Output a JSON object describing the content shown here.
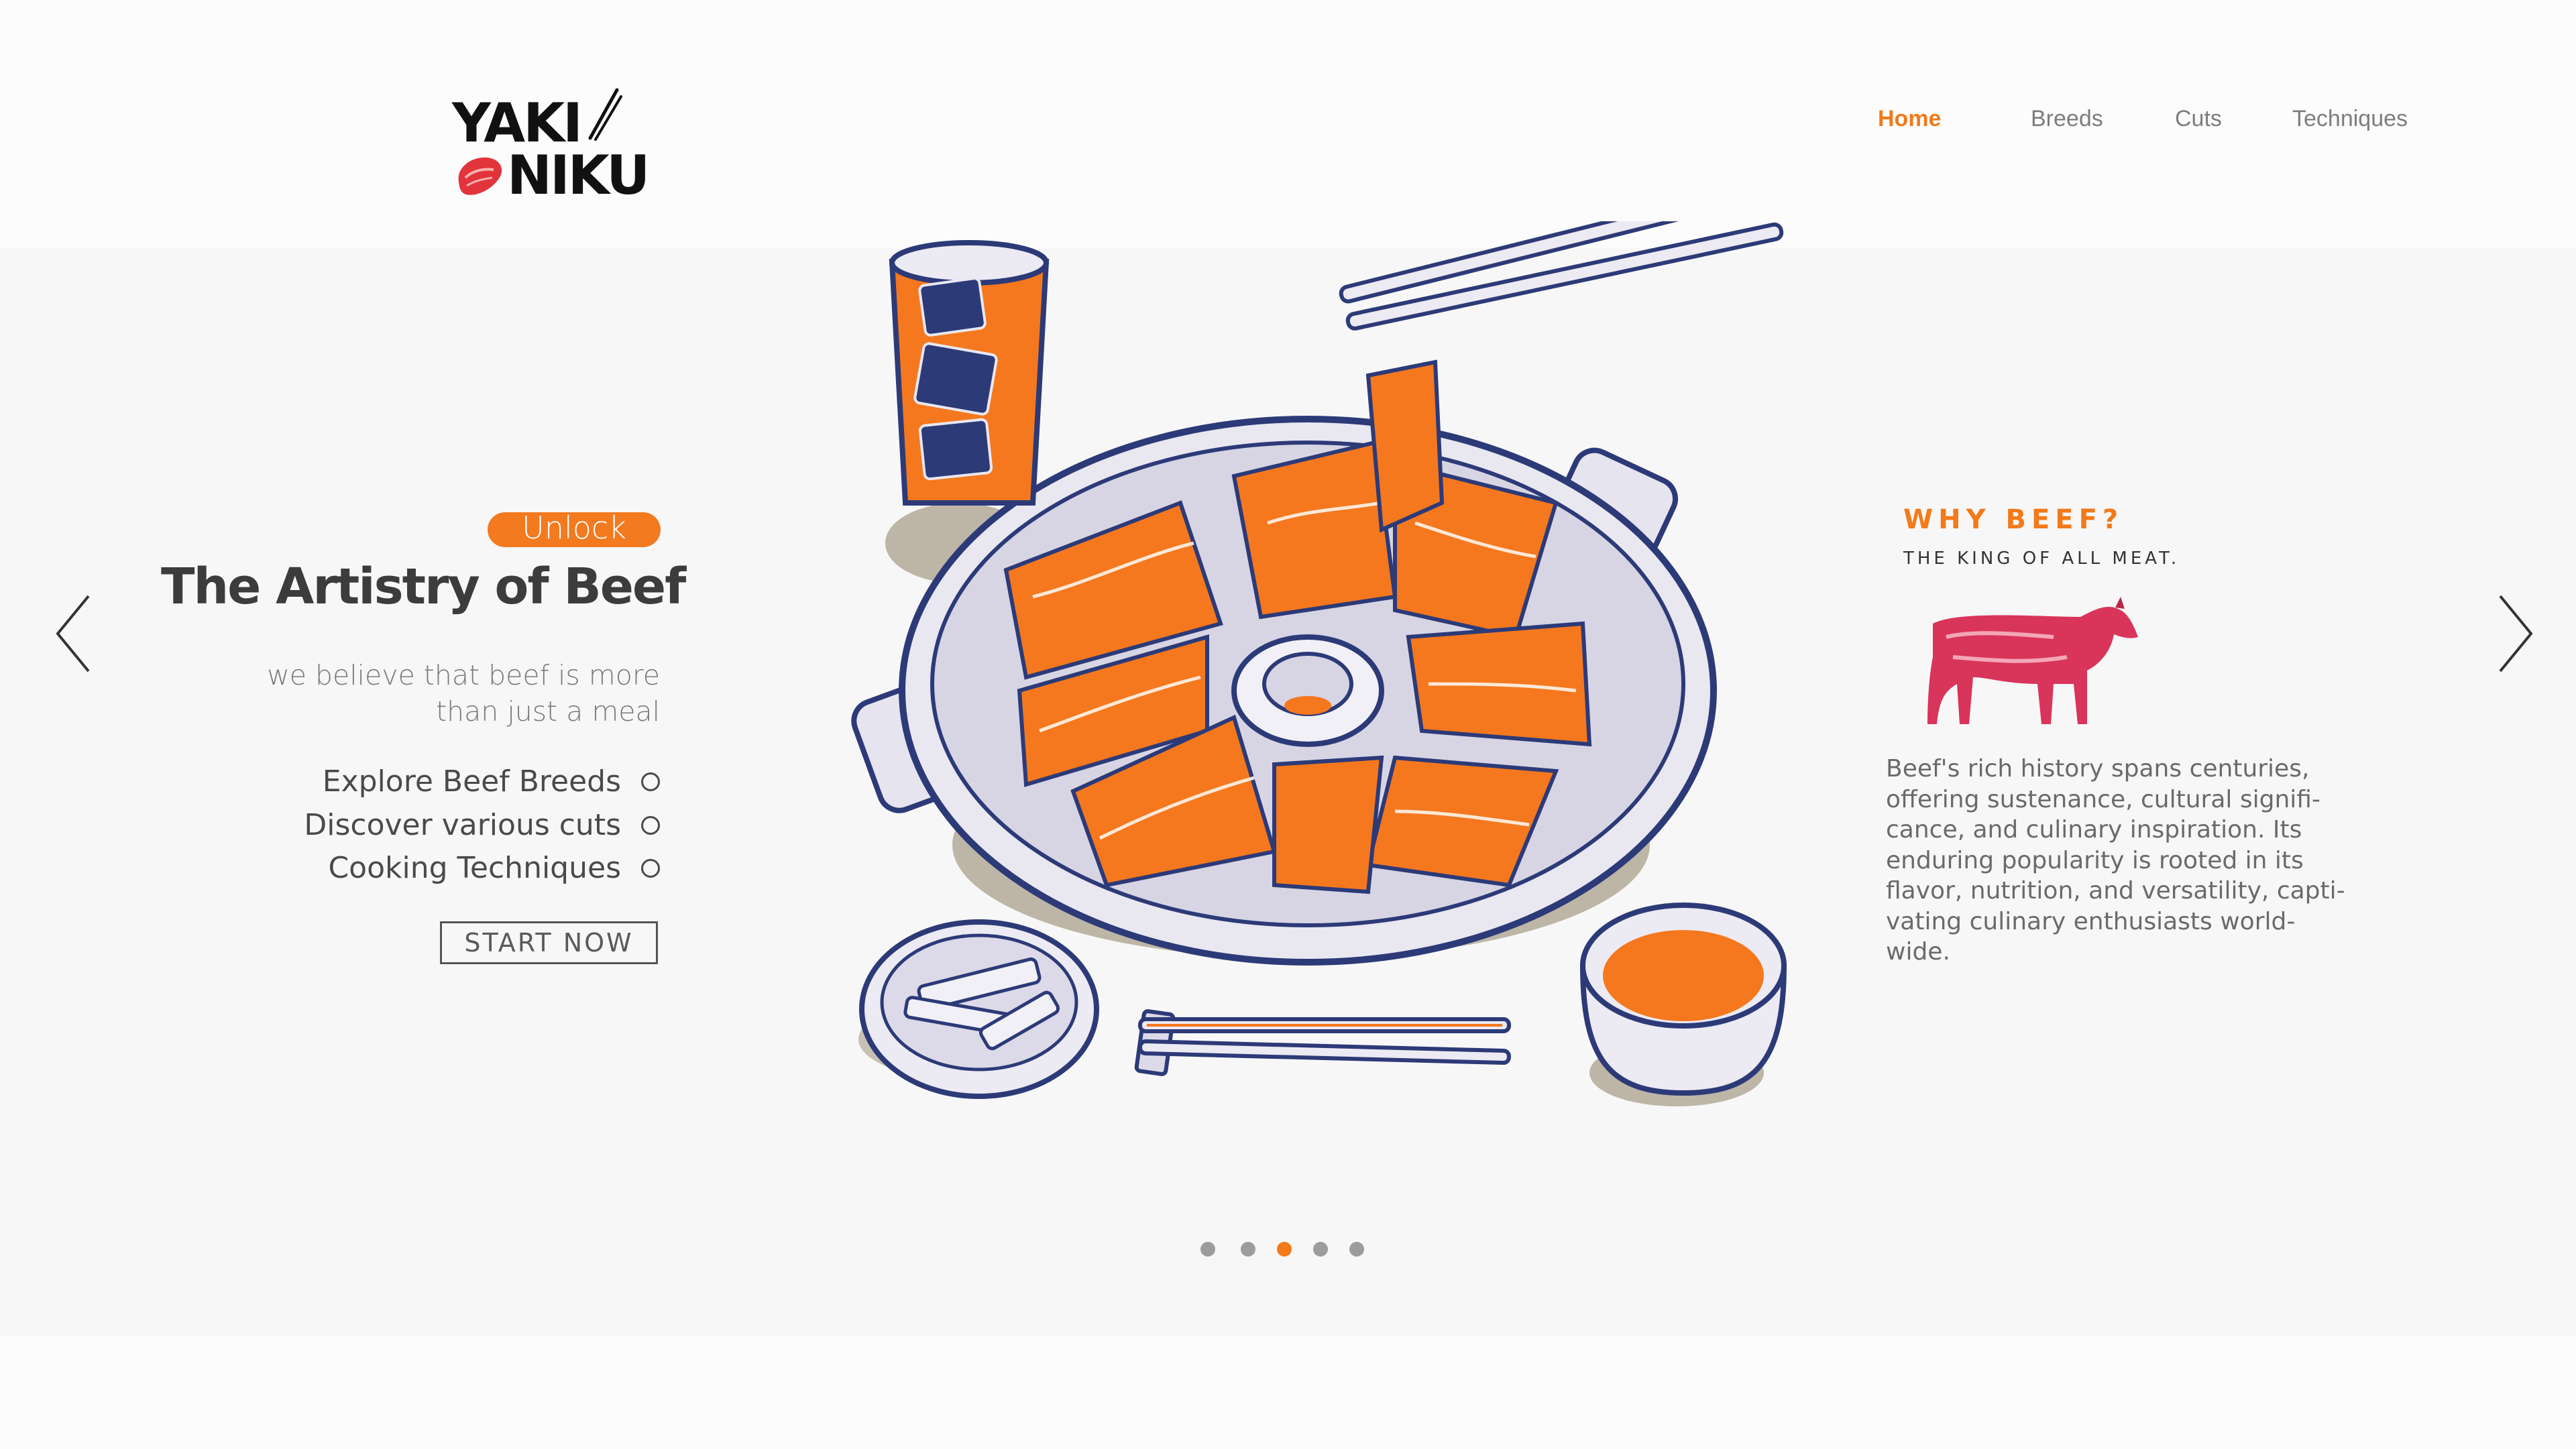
{
  "logo": {
    "line1": "YAKI",
    "line2": "NIKU"
  },
  "nav": {
    "items": [
      {
        "label": "Home",
        "active": true
      },
      {
        "label": "Breeds",
        "active": false
      },
      {
        "label": "Cuts",
        "active": false
      },
      {
        "label": "Techniques",
        "active": false
      }
    ]
  },
  "hero": {
    "badge": "Unlock",
    "title": "The Artistry of Beef",
    "subtitle_line1": "we believe that beef is more",
    "subtitle_line2": "than just a meal",
    "features": [
      "Explore Beef Breeds",
      "Discover various cuts",
      "Cooking Techniques"
    ],
    "cta": "START NOW"
  },
  "why": {
    "title": "WHY BEEF?",
    "subtitle": "THE KING OF ALL MEAT.",
    "body": "Beef's rich history spans centuries, offering sustenance, cultural signifi-cance, and culinary inspiration. Its enduring popularity is rooted in its flavor, nutrition, and versatility, capti-vating culinary enthusiasts world-wide."
  },
  "carousel": {
    "slide_count": 5,
    "active_index": 2
  },
  "icons": {
    "prev": "chevron-left-icon",
    "next": "chevron-right-icon",
    "logo_chopsticks": "chopsticks-icon",
    "logo_meat": "meat-icon",
    "cow": "cow-icon"
  },
  "colors": {
    "accent": "#f27a1a",
    "navy": "#2c3a78",
    "text_dark": "#3c3c3c",
    "text_muted": "#7a7a7a",
    "cow": "#d9345a"
  }
}
